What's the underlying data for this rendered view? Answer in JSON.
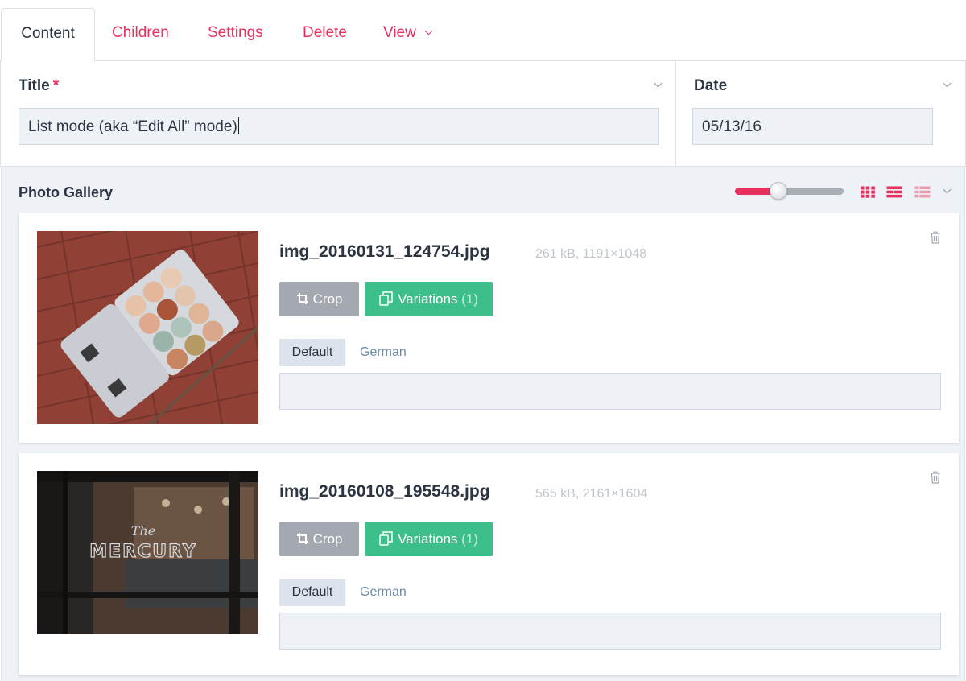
{
  "tabs": {
    "content": "Content",
    "children": "Children",
    "settings": "Settings",
    "delete": "Delete",
    "view": "View"
  },
  "fields": {
    "title_label": "Title",
    "title_required_mark": "*",
    "title_value": "List mode (aka “Edit All” mode)",
    "date_label": "Date",
    "date_value": "05/13/16"
  },
  "gallery": {
    "title": "Photo Gallery",
    "size_slider_level": 0.4,
    "view_modes": [
      "grid-icon",
      "list-detail-icon",
      "list-icon"
    ],
    "accent_color": "#e8305f",
    "items": [
      {
        "filename": "img_20160131_124754.jpg",
        "meta": "261 kB, 1191×1048",
        "crop_label": "Crop",
        "variations_label": "Variations",
        "variations_count": "(1)",
        "lang_default": "Default",
        "lang_german": "German",
        "caption": "",
        "thumb": "eggs-carton-photo"
      },
      {
        "filename": "img_20160108_195548.jpg",
        "meta": "565 kB, 2161×1604",
        "crop_label": "Crop",
        "variations_label": "Variations",
        "variations_count": "(1)",
        "lang_default": "Default",
        "lang_german": "German",
        "caption": "",
        "thumb": "restaurant-door-photo",
        "thumb_text": "MERCURY",
        "thumb_script": "The"
      }
    ]
  },
  "colors": {
    "brand_pink": "#e8305f",
    "crop_gray": "#a3a8b1",
    "variations_green": "#3cbf8b"
  }
}
